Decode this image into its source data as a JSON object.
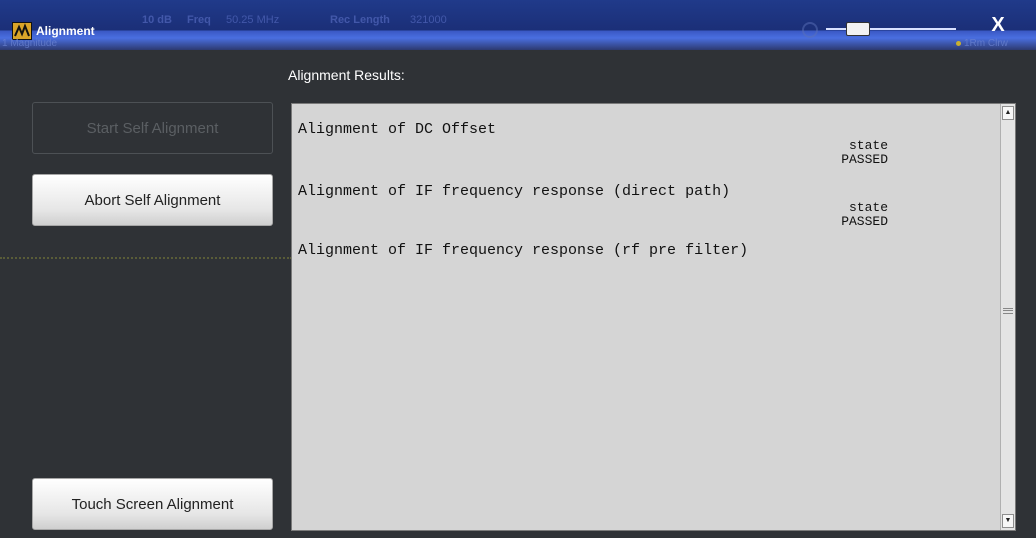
{
  "window": {
    "title": "Alignment",
    "close_glyph": "X",
    "background_labels": {
      "ref": "10 dB",
      "freq_label": "Freq",
      "freq_value": "50.25 MHz",
      "rec_label": "Rec Length",
      "rec_value": "321000",
      "magnitude": "1 Magnitude",
      "trace": "1Rm Clrw"
    }
  },
  "results": {
    "label": "Alignment Results:",
    "entries": [
      {
        "text": "Alignment of DC Offset",
        "state_label": "state",
        "state_value": "PASSED"
      },
      {
        "text": "Alignment of IF frequency response (direct path)",
        "state_label": "state",
        "state_value": "PASSED"
      },
      {
        "text": "Alignment of IF frequency response (rf pre filter)"
      }
    ]
  },
  "buttons": {
    "start": "Start Self Alignment",
    "abort": "Abort Self Alignment",
    "touch": "Touch Screen Alignment"
  },
  "icons": {
    "app": "alignment-app-icon",
    "close": "close-icon",
    "scroll_up": "scroll-up-arrow-icon",
    "scroll_down": "scroll-down-arrow-icon",
    "scroll_grip": "scroll-grip-icon"
  },
  "colors": {
    "titlebar": "#1b2f78",
    "background": "#2f3236",
    "results_bg": "#d5d5d5",
    "button_face": "#e6e6e6",
    "disabled_text": "#5b5f63"
  }
}
